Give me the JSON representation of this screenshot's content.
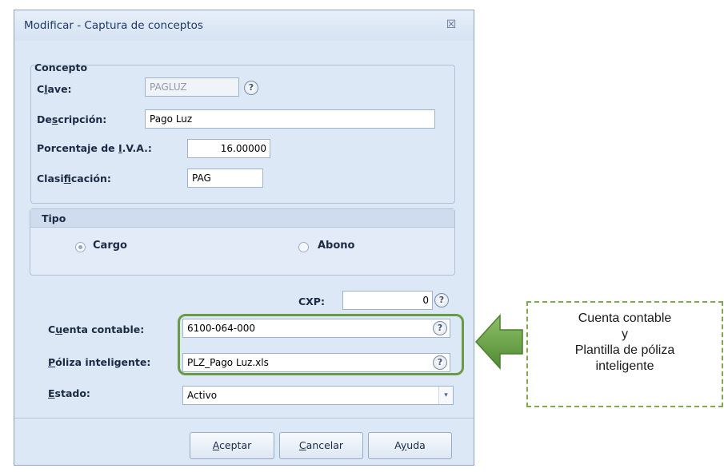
{
  "dialog": {
    "title": "Modificar - Captura de conceptos",
    "close_glyph": "☒"
  },
  "concepto": {
    "legend": "Concepto",
    "clave": {
      "label_pre": "C",
      "label_u": "l",
      "label_post": "ave:",
      "value": "PAGLUZ"
    },
    "descripcion": {
      "label_pre": "De",
      "label_u": "s",
      "label_post": "cripción:",
      "value": "Pago Luz"
    },
    "iva": {
      "label_pre": "Porcentaje de ",
      "label_u": "I",
      "label_post": ".V.A.:",
      "value": "16.00000"
    },
    "clasificacion": {
      "label_pre": "Clasi",
      "label_u": "f",
      "label_post": "icación:",
      "value": "PAG"
    }
  },
  "tipo": {
    "legend": "Tipo",
    "options": [
      {
        "label": "Cargo",
        "selected": true
      },
      {
        "label": "Abono",
        "selected": false
      }
    ]
  },
  "cxp": {
    "label": "CXP:",
    "value": "0"
  },
  "cuenta_contable": {
    "label_pre": "C",
    "label_u": "u",
    "label_post": "enta contable:",
    "value": "6100-064-000"
  },
  "poliza": {
    "label_pre": "",
    "label_u": "P",
    "label_post": "óliza inteligente:",
    "value": "PLZ_Pago Luz.xls"
  },
  "estado": {
    "label_pre": "",
    "label_u": "E",
    "label_post": "stado:",
    "value": "Activo"
  },
  "help_glyph": "?",
  "dropdown_glyph": "▾",
  "buttons": {
    "aceptar": {
      "u": "A",
      "rest": "ceptar"
    },
    "cancelar": {
      "u": "C",
      "rest": "ancelar"
    },
    "ayuda": {
      "pre": "A",
      "u": "y",
      "rest": "uda"
    }
  },
  "callout": {
    "lines": [
      "Cuenta contable",
      "y",
      "Plantilla de póliza",
      "inteligente"
    ]
  },
  "colors": {
    "highlight": "#6b9a45",
    "arrow": "#5e9a3c",
    "callout_border": "#7eaa4d",
    "dialog_bg": "#dde8f6"
  }
}
